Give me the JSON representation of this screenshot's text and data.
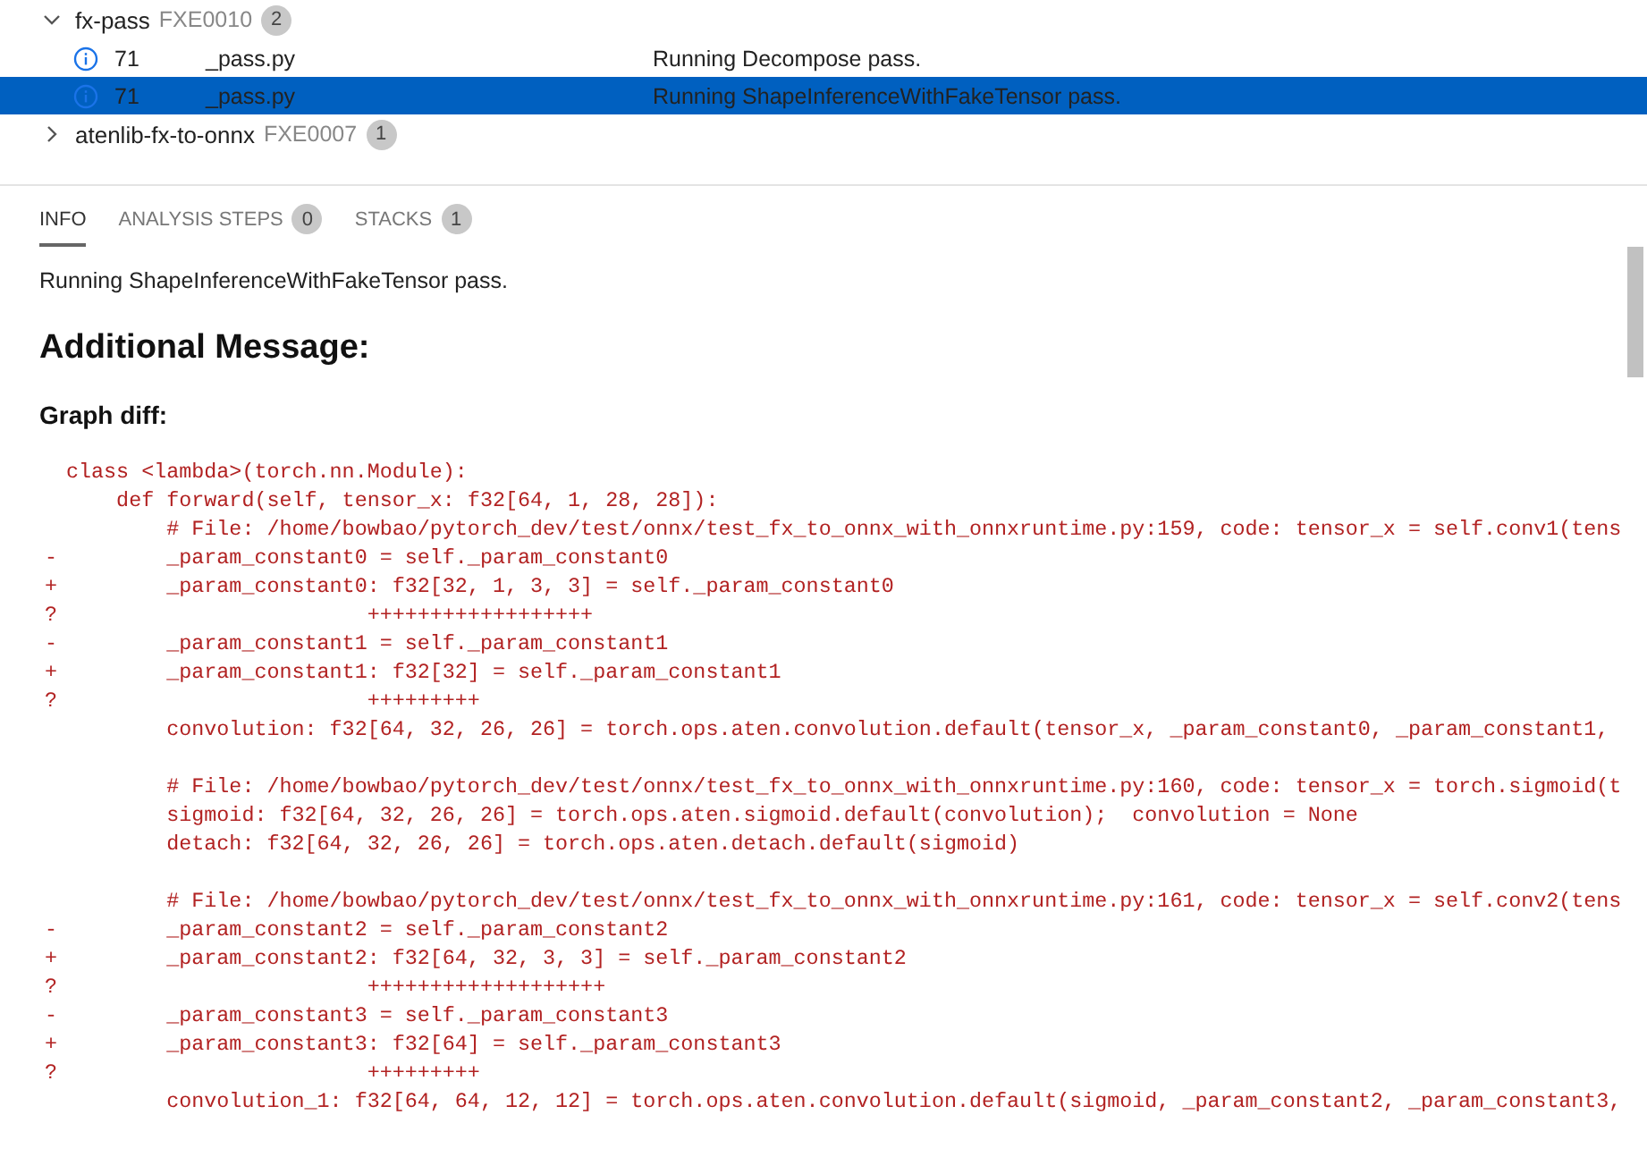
{
  "results": [
    {
      "rule": "fx-pass",
      "code": "FXE0010",
      "count": "2",
      "expanded": true,
      "items": [
        {
          "line": "71",
          "file": "_pass.py",
          "message": "Running Decompose pass.",
          "selected": false
        },
        {
          "line": "71",
          "file": "_pass.py",
          "message": "Running ShapeInferenceWithFakeTensor pass.",
          "selected": true
        }
      ]
    },
    {
      "rule": "atenlib-fx-to-onnx",
      "code": "FXE0007",
      "count": "1",
      "expanded": false
    }
  ],
  "tabs": [
    {
      "label": "INFO",
      "selected": true
    },
    {
      "label": "ANALYSIS STEPS",
      "count": "0",
      "selected": false
    },
    {
      "label": "STACKS",
      "count": "1",
      "selected": false
    }
  ],
  "info": {
    "message": "Running ShapeInferenceWithFakeTensor pass.",
    "heading": "Additional Message:",
    "subheading": "Graph diff:",
    "diff_blocks": [
      {
        "lines": [
          {
            "code": "class <lambda>(torch.nn.Module):"
          },
          {
            "code": "    def forward(self, tensor_x: f32[64, 1, 28, 28]):"
          },
          {
            "code": "        # File: /home/bowbao/pytorch_dev/test/onnx/test_fx_to_onnx_with_onnxruntime.py:159, code: tensor_x = self.conv1(tens"
          },
          {
            "marker": "-",
            "code": "        _param_constant0 = self._param_constant0"
          },
          {
            "marker": "+",
            "code": "        _param_constant0: f32[32, 1, 3, 3] = self._param_constant0"
          },
          {
            "marker": "?",
            "code": "                        ++++++++++++++++++"
          },
          {
            "marker": "-",
            "code": "        _param_constant1 = self._param_constant1"
          },
          {
            "marker": "+",
            "code": "        _param_constant1: f32[32] = self._param_constant1"
          },
          {
            "marker": "?",
            "code": "                        +++++++++"
          },
          {
            "code": "        convolution: f32[64, 32, 26, 26] = torch.ops.aten.convolution.default(tensor_x, _param_constant0, _param_constant1,"
          }
        ]
      },
      {
        "lines": [
          {
            "code": "        # File: /home/bowbao/pytorch_dev/test/onnx/test_fx_to_onnx_with_onnxruntime.py:160, code: tensor_x = torch.sigmoid(t"
          },
          {
            "code": "        sigmoid: f32[64, 32, 26, 26] = torch.ops.aten.sigmoid.default(convolution);  convolution = None"
          },
          {
            "code": "        detach: f32[64, 32, 26, 26] = torch.ops.aten.detach.default(sigmoid)"
          }
        ]
      },
      {
        "lines": [
          {
            "code": "        # File: /home/bowbao/pytorch_dev/test/onnx/test_fx_to_onnx_with_onnxruntime.py:161, code: tensor_x = self.conv2(tens"
          },
          {
            "marker": "-",
            "code": "        _param_constant2 = self._param_constant2"
          },
          {
            "marker": "+",
            "code": "        _param_constant2: f32[64, 32, 3, 3] = self._param_constant2"
          },
          {
            "marker": "?",
            "code": "                        +++++++++++++++++++"
          },
          {
            "marker": "-",
            "code": "        _param_constant3 = self._param_constant3"
          },
          {
            "marker": "+",
            "code": "        _param_constant3: f32[64] = self._param_constant3"
          },
          {
            "marker": "?",
            "code": "                        +++++++++"
          },
          {
            "code": "        convolution_1: f32[64, 64, 12, 12] = torch.ops.aten.convolution.default(sigmoid, _param_constant2, _param_constant3,"
          }
        ]
      }
    ]
  }
}
